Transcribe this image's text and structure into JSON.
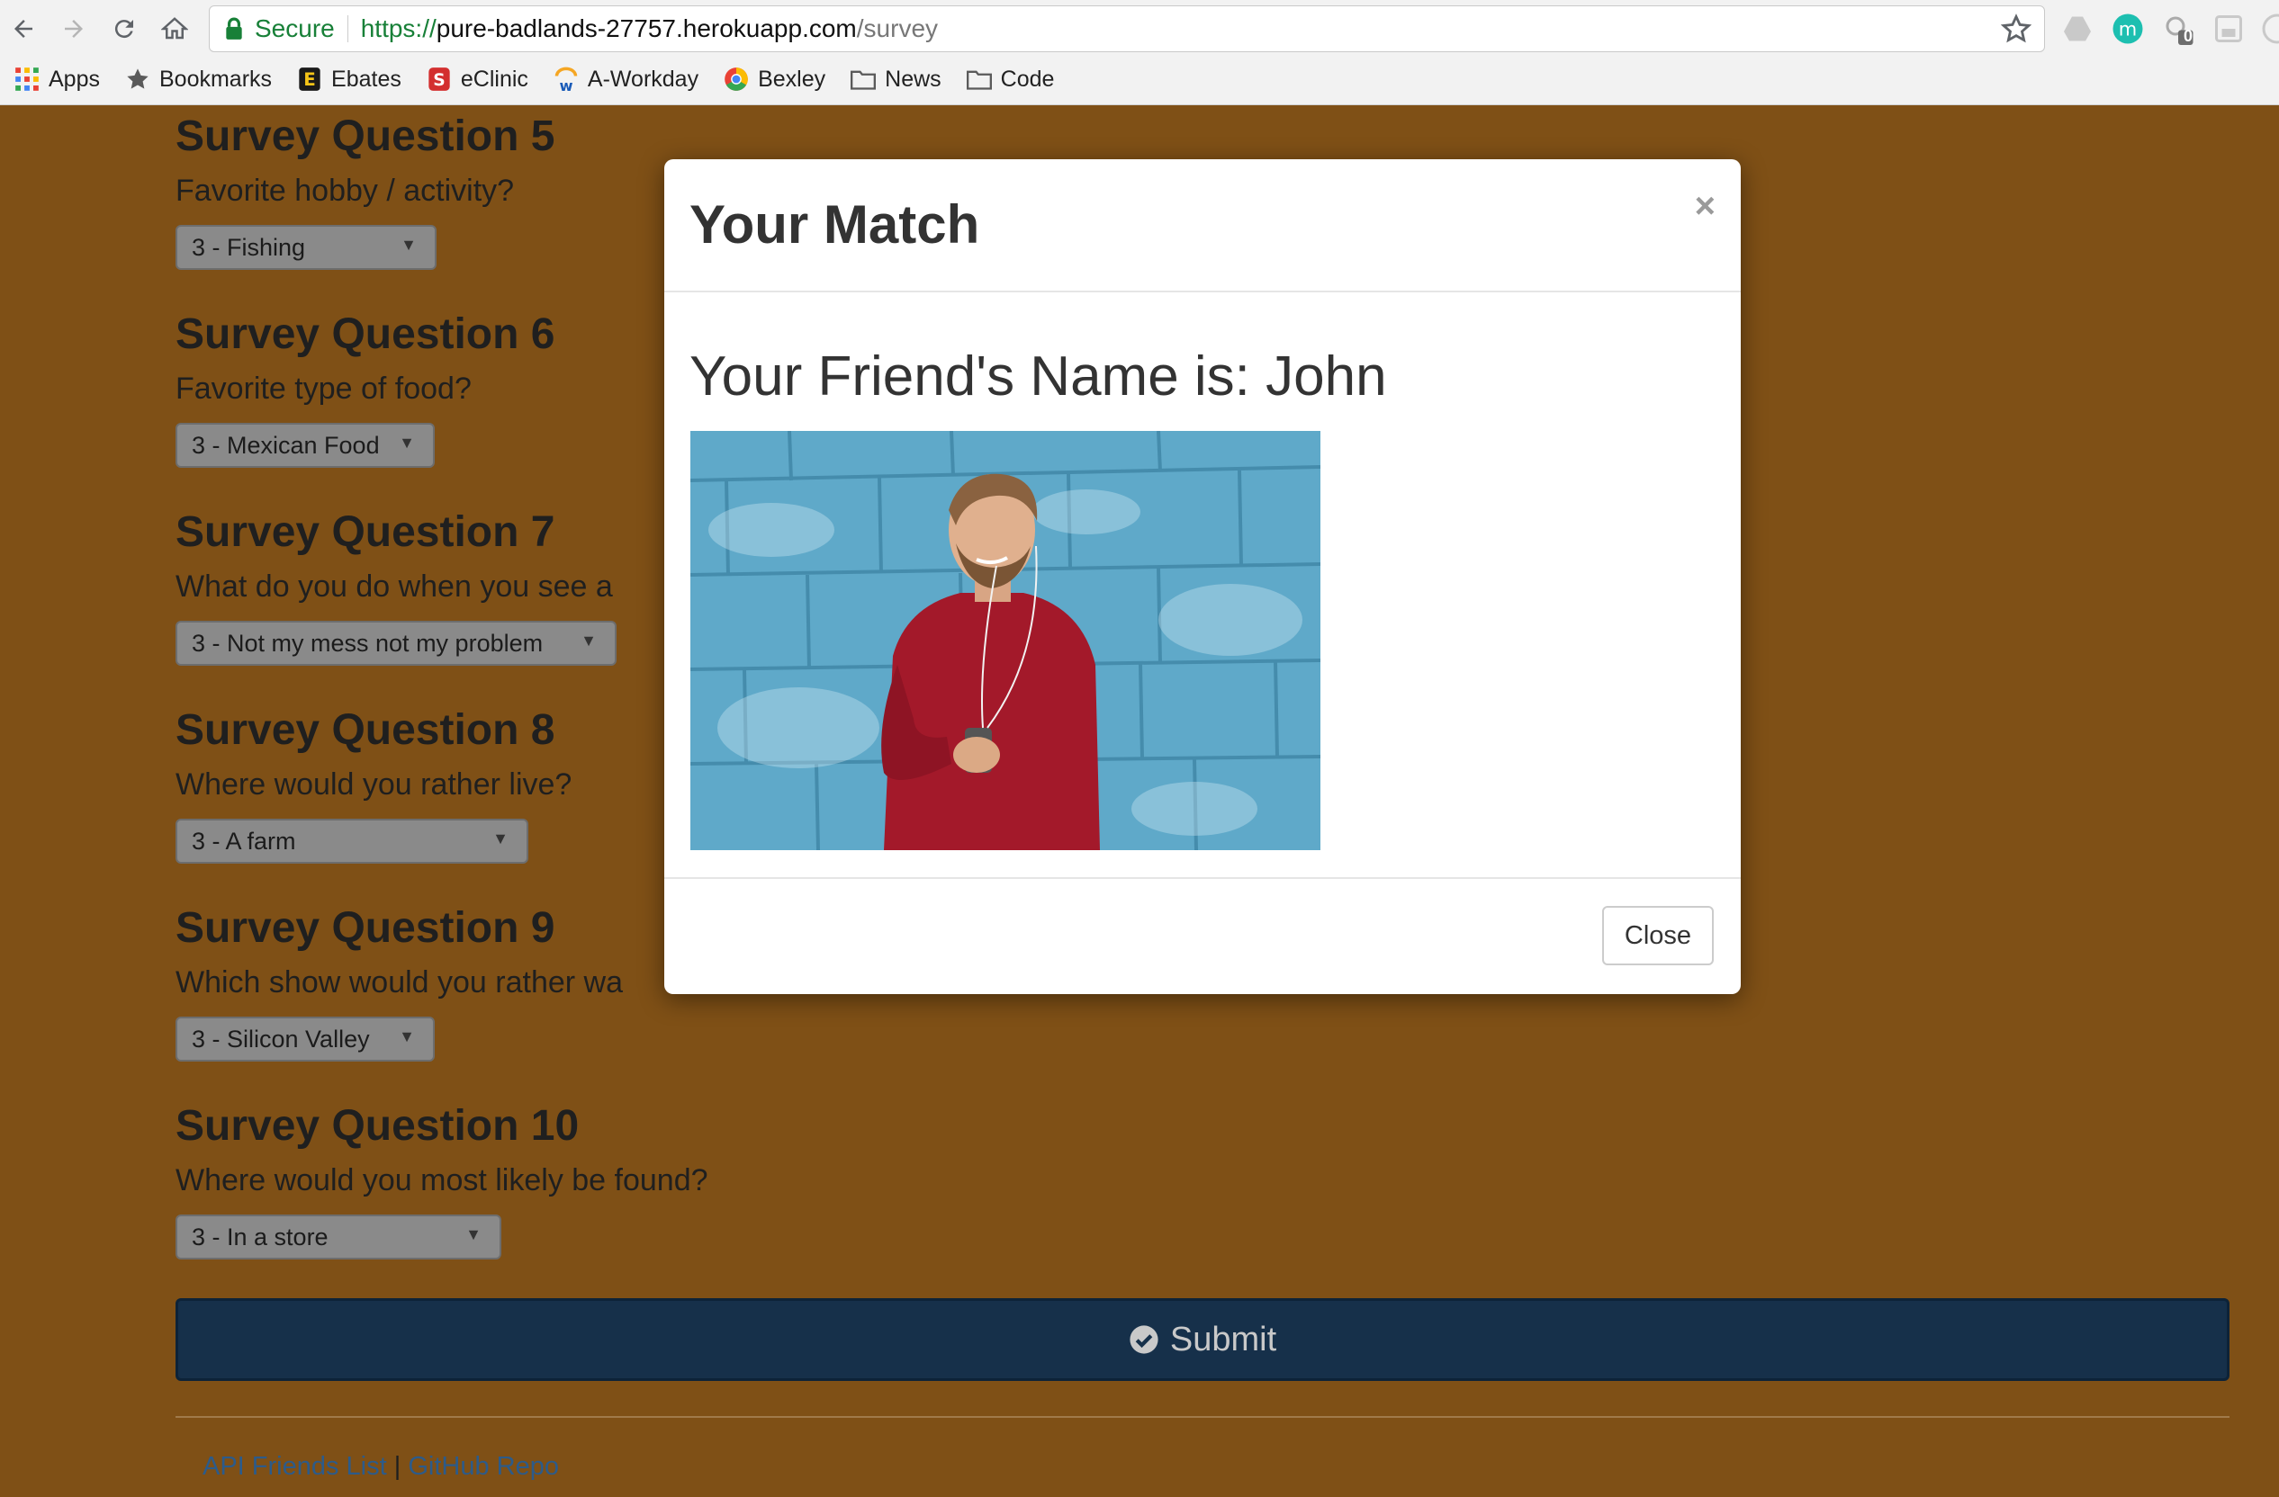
{
  "browser": {
    "secure_label": "Secure",
    "url_scheme": "https://",
    "url_host": "pure-badlands-27757.herokuapp.com",
    "url_path": "/survey",
    "extension_badge": "0",
    "bookmarks": [
      {
        "label": "Apps",
        "icon": "apps-grid-icon"
      },
      {
        "label": "Bookmarks",
        "icon": "star-icon"
      },
      {
        "label": "Ebates",
        "icon": "ebates-icon"
      },
      {
        "label": "eClinic",
        "icon": "eclinic-icon"
      },
      {
        "label": "A-Workday",
        "icon": "workday-icon"
      },
      {
        "label": "Bexley",
        "icon": "chrome-icon"
      },
      {
        "label": "News",
        "icon": "folder-icon"
      },
      {
        "label": "Code",
        "icon": "folder-icon"
      }
    ]
  },
  "survey": {
    "questions": [
      {
        "title": "Survey Question 5",
        "text": "Favorite hobby / activity?",
        "selected": "3 - Fishing"
      },
      {
        "title": "Survey Question 6",
        "text": "Favorite type of food?",
        "selected": "3 - Mexican Food"
      },
      {
        "title": "Survey Question 7",
        "text": "What do you do when you see a",
        "selected": "3 - Not my mess not my problem"
      },
      {
        "title": "Survey Question 8",
        "text": "Where would you rather live?",
        "selected": "3 - A farm"
      },
      {
        "title": "Survey Question 9",
        "text": "Which show would you rather wa",
        "selected": "3 - Silicon Valley"
      },
      {
        "title": "Survey Question 10",
        "text": "Where would you most likely be found?",
        "selected": "3 - In a store"
      }
    ],
    "submit_label": "Submit",
    "footer": {
      "link1": "API Friends List",
      "separator": "|",
      "link2": "GitHub Repo"
    }
  },
  "modal": {
    "title": "Your Match",
    "close_x": "×",
    "friend_line": "Your Friend's Name is: John",
    "close_label": "Close"
  },
  "colors": {
    "page_bg": "#7f5016",
    "submit_bg": "#16304a",
    "link": "#2c5b8a",
    "secure_green": "#188038"
  }
}
